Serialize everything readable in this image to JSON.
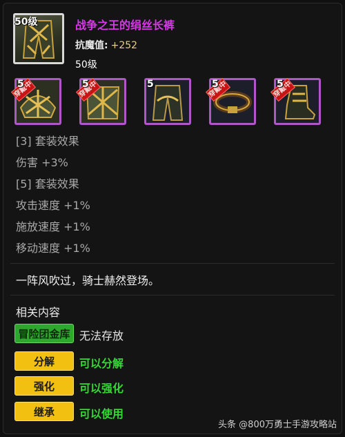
{
  "item": {
    "level_badge": "50级",
    "name": "战争之王的绢丝长裤",
    "name_color": "#d838e8",
    "stat_label": "抗魔值:",
    "stat_value": "+252",
    "required_level": "50级",
    "icon": "armored-pants-icon"
  },
  "set_slots": [
    {
      "num": "5",
      "tag": "穿戴中",
      "worn": true,
      "icon": "shoulder-armor-icon"
    },
    {
      "num": "5",
      "tag": "穿戴中",
      "worn": true,
      "icon": "chest-armor-icon"
    },
    {
      "num": "5",
      "tag": "",
      "worn": false,
      "icon": "pants-armor-icon"
    },
    {
      "num": "5",
      "tag": "穿戴中",
      "worn": true,
      "icon": "belt-icon"
    },
    {
      "num": "5",
      "tag": "穿戴中",
      "worn": true,
      "icon": "boots-icon"
    }
  ],
  "set_effects": [
    "[3] 套装效果",
    "伤害 +3%",
    "[5] 套装效果",
    "攻击速度 +1%",
    "施放速度 +1%",
    "移动速度 +1%"
  ],
  "flavor_text": "一阵风吹过，骑士赫然登场。",
  "related": {
    "heading": "相关内容",
    "rows": [
      {
        "button": "冒险团金库",
        "style": "green",
        "text": "无法存放",
        "text_color": "#e6e6e6"
      },
      {
        "button": "分解",
        "style": "yellow",
        "text": "可以分解",
        "text_color": "#34d834"
      },
      {
        "button": "强化",
        "style": "yellow",
        "text": "可以强化",
        "text_color": "#34d834"
      },
      {
        "button": "继承",
        "style": "yellow",
        "text": "可以使用",
        "text_color": "#34d834"
      }
    ]
  },
  "watermark": "头条 @800万勇士手游攻略站"
}
